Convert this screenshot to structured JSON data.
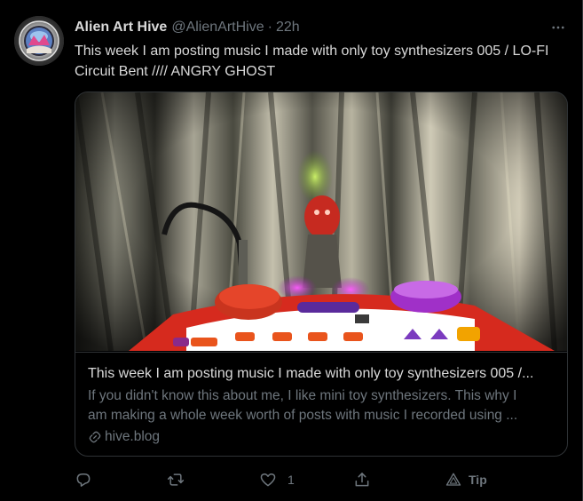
{
  "tweet": {
    "author": {
      "display_name": "Alien Art Hive",
      "handle": "@AlienArtHive",
      "separator": "·",
      "time": "22h"
    },
    "text": "This week I am posting music I made with only toy synthesizers 005 / LO-FI Circuit Bent //// ANGRY GHOST",
    "card": {
      "title": "This week I am posting music I made with only toy synthesizers 005 /...",
      "description_line1": "If you didn't know this about me, I like mini toy synthesizers. This why I",
      "description_line2": "am making a whole week worth of posts with music I recorded using ...",
      "domain": "hive.blog"
    },
    "actions": {
      "reply_count": "",
      "retweet_count": "",
      "like_count": "1",
      "tip_label": "Tip"
    }
  },
  "icons": {
    "more": "more-horizontal-icon",
    "reply": "reply-icon",
    "retweet": "retweet-icon",
    "like": "heart-icon",
    "share": "share-icon",
    "tip": "tip-icon",
    "link": "link-icon"
  },
  "colors": {
    "background": "#000000",
    "text_primary": "#d9d9d9",
    "text_secondary": "#6e767d",
    "border": "#2f3336"
  }
}
